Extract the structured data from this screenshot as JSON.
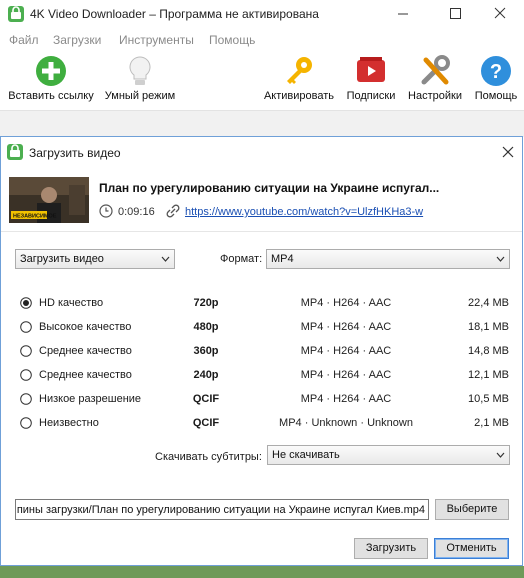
{
  "window": {
    "title": "4K Video Downloader – Программа не активирована"
  },
  "menu": {
    "items": [
      "Файл",
      "Загрузки",
      "Инструменты",
      "Помощь"
    ]
  },
  "toolbar": {
    "paste_link": "Вставить ссылку",
    "smart_mode": "Умный режим",
    "activate": "Активировать",
    "subscriptions": "Подписки",
    "settings": "Настройки",
    "help": "Помощь"
  },
  "dialog": {
    "title": "Загрузить видео",
    "video": {
      "title": "План по урегулированию ситуации на Украине испугал...",
      "duration": "0:09:16",
      "url": "https://www.youtube.com/watch?v=UlzfHKHa3-w",
      "thumbnail_badge": "НЕЗАВИСИМОЕ"
    },
    "download_type": "Загрузить видео",
    "format_label": "Формат:",
    "format_value": "MP4",
    "qualities": [
      {
        "name": "HD качество",
        "resolution": "720p",
        "codec": "MP4 · H264 · AAC",
        "size": "22,4 MB",
        "selected": true
      },
      {
        "name": "Высокое качество",
        "resolution": "480p",
        "codec": "MP4 · H264 · AAC",
        "size": "18,1 MB",
        "selected": false
      },
      {
        "name": "Среднее качество",
        "resolution": "360p",
        "codec": "MP4 · H264 · AAC",
        "size": "14,8 MB",
        "selected": false
      },
      {
        "name": "Среднее качество",
        "resolution": "240p",
        "codec": "MP4 · H264 · AAC",
        "size": "12,1 MB",
        "selected": false
      },
      {
        "name": "Низкое разрешение",
        "resolution": "QCIF",
        "codec": "MP4 · H264 · AAC",
        "size": "10,5 MB",
        "selected": false
      },
      {
        "name": "Неизвестно",
        "resolution": "QCIF",
        "codec": "MP4 · Unknown · Unknown",
        "size": "2,1 MB",
        "selected": false
      }
    ],
    "subtitles_label": "Скачивать субтитры:",
    "subtitles_value": "Не скачивать",
    "path": "пины загрузки/План по урегулированию ситуации на Украине испугал Киев.mp4",
    "browse_label": "Выберите",
    "download_label": "Загрузить",
    "cancel_label": "Отменить"
  },
  "colors": {
    "accent_green": "#3fae3f",
    "link_blue": "#1a4fb3",
    "focus_blue": "#3c7fd6"
  }
}
